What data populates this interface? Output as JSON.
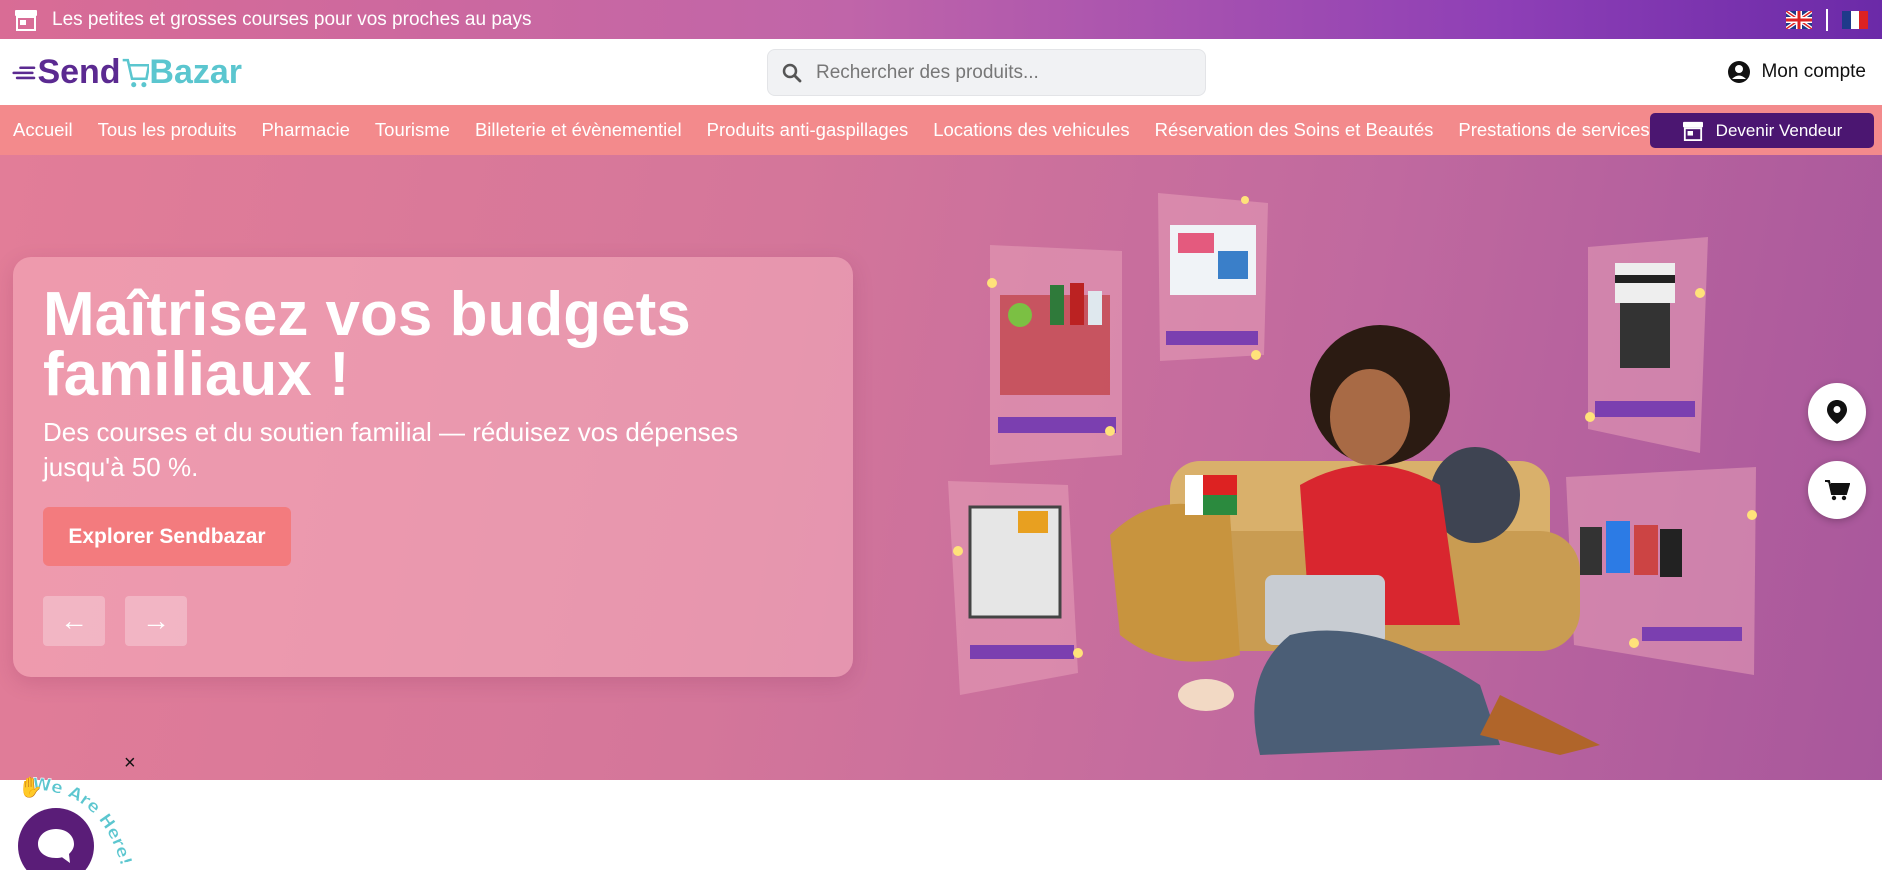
{
  "topbar": {
    "message": "Les petites et grosses courses pour vos proches au pays",
    "icon": "shop-icon",
    "languages": [
      "English",
      "Français"
    ]
  },
  "header": {
    "logo_send": "Send",
    "logo_bazar": "Bazar",
    "search_placeholder": "Rechercher des produits...",
    "account_label": "Mon compte"
  },
  "nav": {
    "items": [
      "Accueil",
      "Tous les produits",
      "Pharmacie",
      "Tourisme",
      "Billeterie et évènementiel",
      "Produits anti-gaspillages",
      "Locations des vehicules",
      "Réservation des Soins et Beautés",
      "Prestations de services"
    ],
    "vendor_button": "Devenir Vendeur"
  },
  "hero": {
    "title": "Maîtrisez vos budgets familiaux !",
    "subtitle": "Des courses et du soutien familial — réduisez vos dépenses jusqu'à 50 %.",
    "cta": "Explorer Sendbazar",
    "prev": "←",
    "next": "→"
  },
  "chat": {
    "close": "×",
    "label": "We Are Here!"
  },
  "colors": {
    "brand_purple": "#4b1671",
    "nav_pink": "#f38a8c",
    "cta_coral": "#f37b7e",
    "logo_teal": "#5bc6cf"
  }
}
